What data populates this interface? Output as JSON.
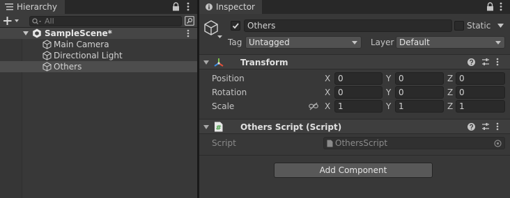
{
  "hierarchy": {
    "tab_label": "Hierarchy",
    "search_placeholder": "All",
    "scene_name": "SampleScene*",
    "items": [
      {
        "label": "Main Camera"
      },
      {
        "label": "Directional Light"
      },
      {
        "label": "Others"
      }
    ],
    "selected_item": "Others"
  },
  "inspector": {
    "tab_label": "Inspector",
    "object_name": "Others",
    "active": true,
    "static_label": "Static",
    "static_checked": false,
    "tag_label": "Tag",
    "tag_value": "Untagged",
    "layer_label": "Layer",
    "layer_value": "Default",
    "transform": {
      "title": "Transform",
      "position_label": "Position",
      "rotation_label": "Rotation",
      "scale_label": "Scale",
      "axis_x": "X",
      "axis_y": "Y",
      "axis_z": "Z",
      "position": {
        "x": "0",
        "y": "0",
        "z": "0"
      },
      "rotation": {
        "x": "0",
        "y": "0",
        "z": "0"
      },
      "scale": {
        "x": "1",
        "y": "1",
        "z": "1"
      }
    },
    "script_component": {
      "title": "Others Script (Script)",
      "script_label": "Script",
      "script_value": "OthersScript"
    },
    "add_component_label": "Add Component"
  },
  "colors": {
    "panel_bg": "#383838",
    "field_bg": "#2a2a2a",
    "selection": "#4d4d4d",
    "transform_icon_green": "#7ec34b",
    "transform_icon_blue": "#3c8ce0",
    "transform_icon_red": "#e0503c"
  }
}
